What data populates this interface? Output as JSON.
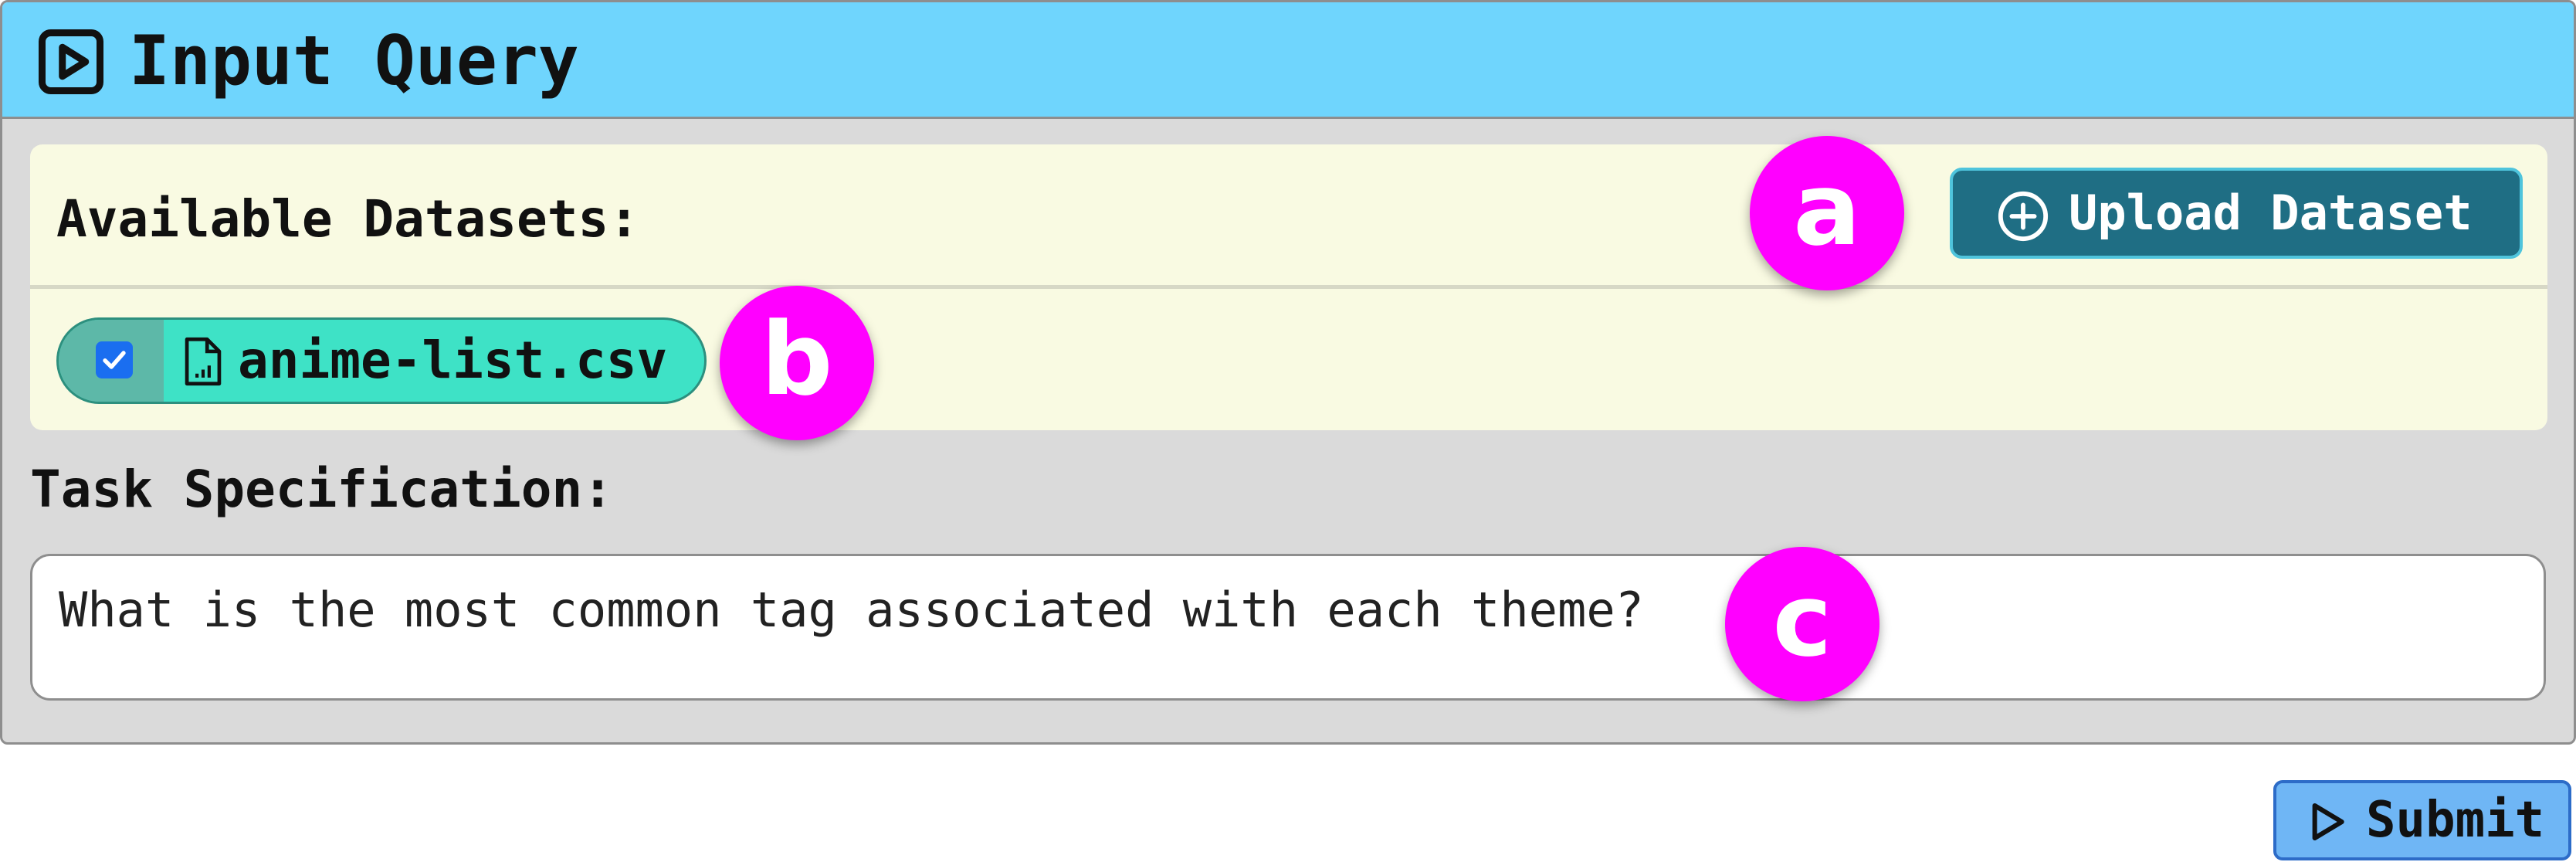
{
  "header": {
    "title": "Input Query",
    "icon": "play-square-icon"
  },
  "datasets": {
    "label": "Available Datasets:",
    "upload_button": {
      "label": "Upload Dataset",
      "icon": "plus-circle-icon"
    },
    "files": [
      {
        "name": "anime-list.csv",
        "checked": true,
        "icon": "file-chart-icon"
      }
    ]
  },
  "task": {
    "label": "Task Specification:",
    "value": "What is the most common tag associated with each theme?"
  },
  "markers": {
    "a": "a",
    "b": "b",
    "c": "c"
  },
  "submit": {
    "label": "Submit",
    "icon": "play-icon"
  },
  "colors": {
    "header_bg": "#6fd5fd",
    "panel_bg": "#dadada",
    "datasets_bg": "#f9fae2",
    "upload_button_bg": "#1f6e84",
    "file_chip_bg": "#3ee2c6",
    "marker": "#ff00ff",
    "submit_bg": "#6fb6f5"
  }
}
